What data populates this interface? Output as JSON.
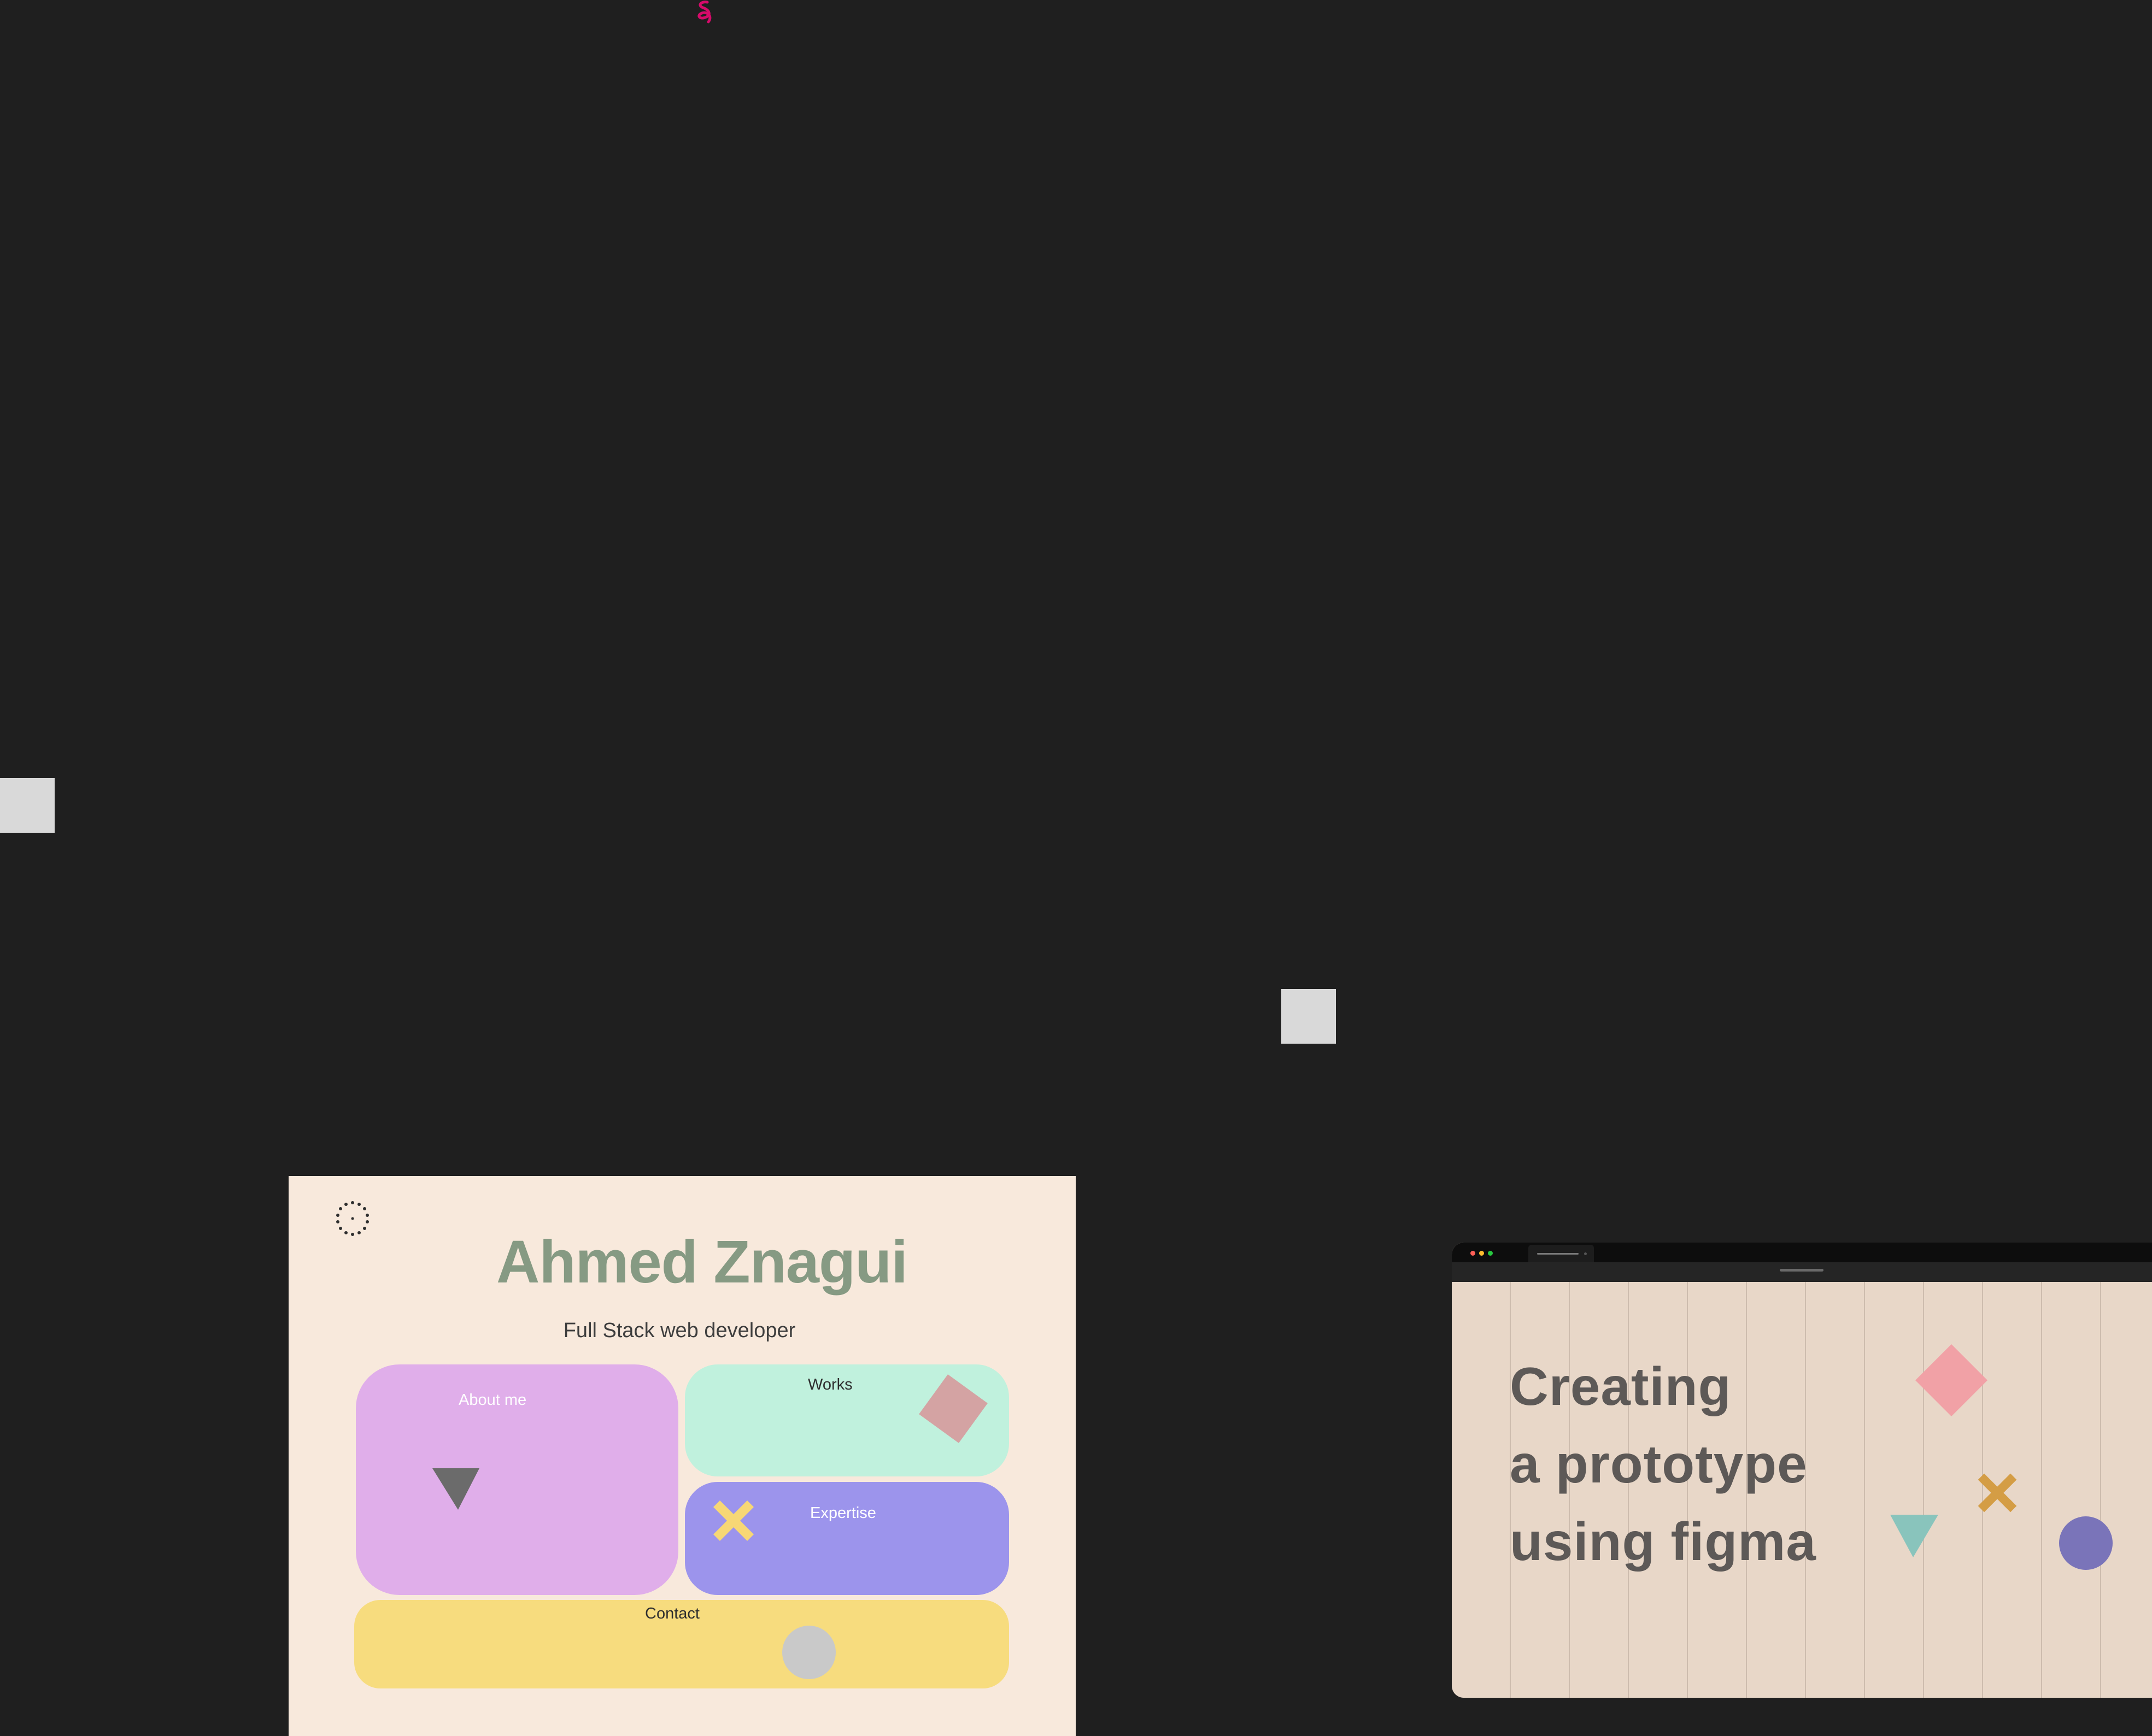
{
  "portfolio": {
    "name": "Ahmed Znagui",
    "subtitle": "Full Stack web developer",
    "cards": {
      "about": "About me",
      "works": "Works",
      "expertise": "Expertise",
      "contact": "Contact"
    }
  },
  "prototype": {
    "headline_lines": [
      "Creating",
      "a prototype",
      "using figma"
    ]
  },
  "colors": {
    "canvas": "#1f1f1f",
    "portfolio_bg": "#f8e9dc",
    "name": "#869a83",
    "about": "#e0aeea",
    "works": "#c0f1dd",
    "expertise": "#9c94ec",
    "contact": "#f7dc7e",
    "prototype_bg": "#e8d7c8"
  },
  "icons": {
    "cursor": "squiggle-cursor-icon",
    "logo": "dotted-circle-logo-icon",
    "traffic_lights": [
      "close-dot-icon",
      "minimize-dot-icon",
      "maximize-dot-icon"
    ]
  }
}
